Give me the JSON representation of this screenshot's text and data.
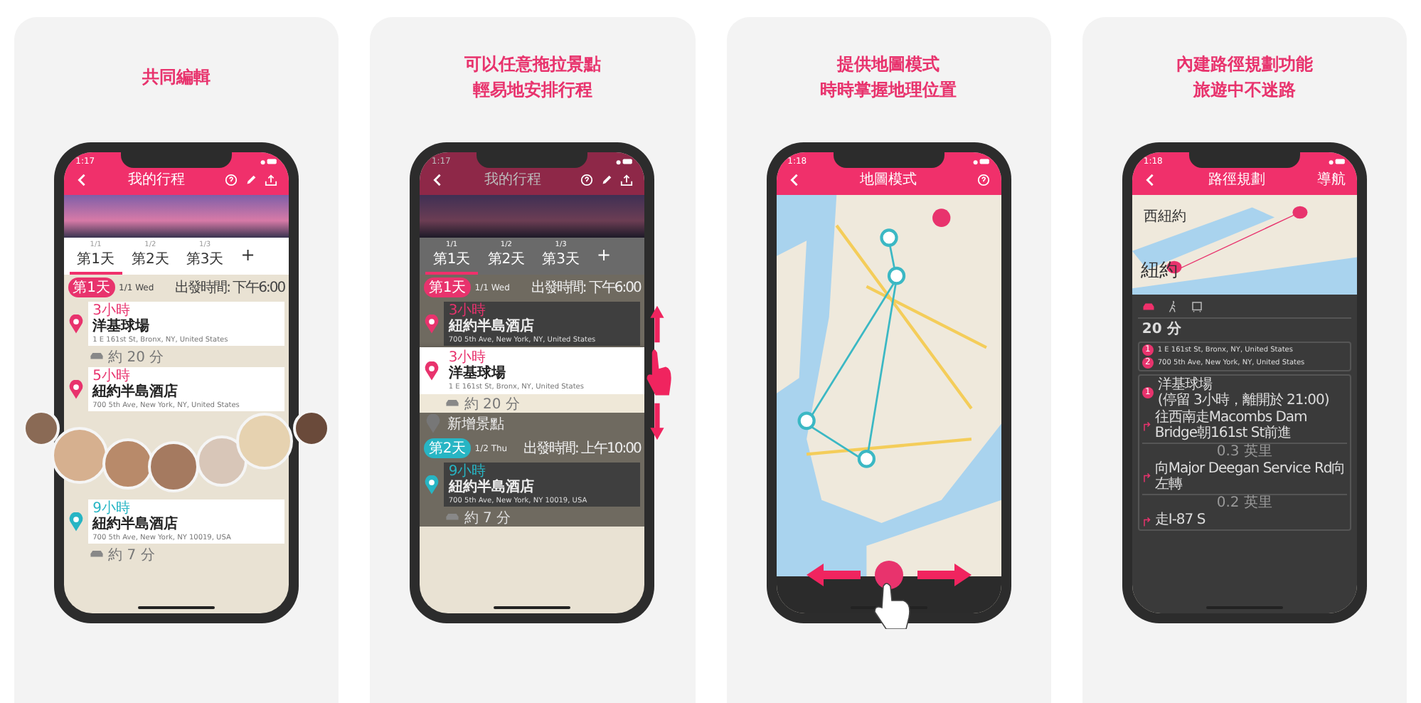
{
  "cards": [
    {
      "caption": [
        "共同編輯"
      ],
      "kind": "faces",
      "phone": {
        "kind": "itinerary",
        "status_time": "1:17",
        "title": "我的行程",
        "dimmed": false,
        "tabs": [
          {
            "date": "1/1",
            "label": "第1天",
            "selected": true
          },
          {
            "date": "1/2",
            "label": "第2天",
            "selected": false
          },
          {
            "date": "1/3",
            "label": "第3天",
            "selected": false
          }
        ],
        "add_tab": "+",
        "days": [
          {
            "badge": "第1天",
            "color": "#e8336d",
            "date": "1/1 Wed",
            "departure": "出發時間: 下午6:00",
            "stops": [
              {
                "duration": "3小時",
                "name": "洋基球場",
                "address": "1 E 161st St, Bronx, NY, United States",
                "travel": "約 20 分",
                "lifted": false
              },
              {
                "duration": "5小時",
                "name": "紐約半島酒店",
                "address": "700 5th Ave, New York, NY, United States",
                "lifted": false
              }
            ]
          },
          {
            "color": "#27b5c4",
            "stops": [
              {
                "duration": "9小時",
                "name": "紐約半島酒店",
                "address": "700 5th Ave, New York, NY 10019, USA",
                "travel": "約 7 分",
                "lifted": false
              }
            ]
          }
        ]
      }
    },
    {
      "caption": [
        "可以任意拖拉景點",
        "輕易地安排行程"
      ],
      "kind": "drag",
      "phone": {
        "kind": "itinerary",
        "status_time": "1:17",
        "title": "我的行程",
        "dimmed": true,
        "tabs": [
          {
            "date": "1/1",
            "label": "第1天",
            "selected": true
          },
          {
            "date": "1/2",
            "label": "第2天",
            "selected": false
          },
          {
            "date": "1/3",
            "label": "第3天",
            "selected": false
          }
        ],
        "add_tab": "+",
        "days": [
          {
            "badge": "第1天",
            "color": "#e8336d",
            "date": "1/1 Wed",
            "departure": "出發時間: 下午6:00",
            "add_label": "新增景點",
            "stops": [
              {
                "duration": "3小時",
                "name": "紐約半島酒店",
                "address": "700 5th Ave, New York, NY, United States",
                "lifted": false
              },
              {
                "duration": "3小時",
                "name": "洋基球場",
                "address": "1 E 161st St, Bronx, NY, United States",
                "travel": "約 20 分",
                "lifted": true
              }
            ]
          },
          {
            "badge": "第2天",
            "color": "#27b5c4",
            "date": "1/2 Thu",
            "departure": "出發時間: 上午10:00",
            "stops": [
              {
                "duration": "9小時",
                "name": "紐約半島酒店",
                "address": "700 5th Ave, New York, NY 10019, USA",
                "travel": "約 7 分",
                "lifted": false
              }
            ]
          }
        ]
      }
    },
    {
      "caption": [
        "提供地圖模式",
        "時時掌握地理位置"
      ],
      "kind": "swipe",
      "phone": {
        "kind": "map",
        "status_time": "1:18",
        "title": "地圖模式"
      }
    },
    {
      "caption": [
        "內建路徑規劃功能",
        "旅遊中不迷路"
      ],
      "kind": "plain",
      "phone": {
        "kind": "route",
        "status_time": "1:18",
        "title": "路徑規劃",
        "action": "導航",
        "map_labels": [
          "西紐約",
          "紐約"
        ],
        "modes": [
          {
            "kind": "car",
            "selected": true
          },
          {
            "kind": "walk",
            "selected": false
          },
          {
            "kind": "transit",
            "selected": false
          }
        ],
        "duration": "20 分",
        "places": [
          {
            "marker": "1",
            "address": "1 E 161st St, Bronx, NY, United States"
          },
          {
            "marker": "2",
            "address": "700 5th Ave, New York, NY, United States"
          }
        ],
        "stop": {
          "marker": "1",
          "name": "洋基球場",
          "note": "(停留 3小時，離開於 21:00)"
        },
        "steps": [
          {
            "text": "往西南走Macombs Dam Bridge朝161st St前進",
            "distance": "0.3 英里"
          },
          {
            "text": "向Major Deegan Service Rd向左轉",
            "distance": "0.2 英里"
          },
          {
            "text": "走I-87 S"
          }
        ]
      }
    }
  ]
}
